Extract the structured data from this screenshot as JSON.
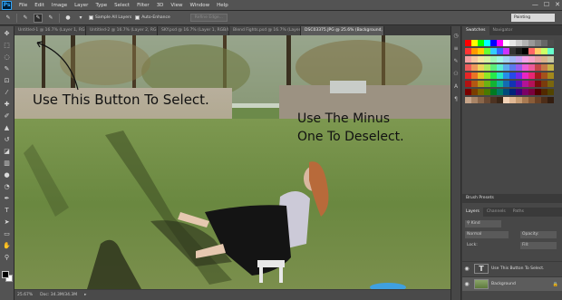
{
  "app": {
    "logo": "Ps",
    "menu": [
      "File",
      "Edit",
      "Image",
      "Layer",
      "Type",
      "Select",
      "Filter",
      "3D",
      "View",
      "Window",
      "Help"
    ],
    "window_controls": [
      "—",
      "☐",
      "✕"
    ]
  },
  "options": {
    "sample_all_layers": "Sample All Layers",
    "auto_enhance": "Auto-Enhance",
    "refine_edge": "Refine Edge...",
    "workspace": "Painting"
  },
  "tabs": [
    {
      "label": "Untitled-1 @ 16.7% (Layer 1, RGB/8)"
    },
    {
      "label": "Untitled-2 @ 16.7% (Layer 2, RGB/8)"
    },
    {
      "label": "SKY.psd @ 16.7% (Layer 1, RGB/8)"
    },
    {
      "label": "Blend Fights.psd @ 16.7% (Layer 1, RGB/8)"
    },
    {
      "label": "DSC03375.JPG @ 25.6% (Background, RGB/8)",
      "active": true
    }
  ],
  "canvas": {
    "text1": "Use This Button To Select.",
    "text2_line1": "Use The Minus",
    "text2_line2": "One To Deselect."
  },
  "status": {
    "zoom": "25.67%",
    "doc": "Doc: 34.3M/34.3M"
  },
  "right_panel": {
    "tab_swatches": "Swatches",
    "tab_navigator": "Navigator",
    "brush_presets": "Brush Presets",
    "layers_tabs": [
      "Layers",
      "Channels",
      "Paths"
    ],
    "kind_label": "Kind",
    "normal_label": "Normal",
    "opacity_label": "Opacity:",
    "lock_label": "Lock:",
    "fill_label": "Fill:",
    "layers": [
      {
        "name": "Use This Button To Select.",
        "type": "text",
        "thumb": "T"
      },
      {
        "name": "Background",
        "type": "image",
        "selected": true
      }
    ]
  },
  "colors": {
    "swatch_rows": [
      [
        "#ff0000",
        "#ffff00",
        "#00ff00",
        "#00ffff",
        "#0000ff",
        "#ff00ff",
        "#ffffff",
        "#e6e6e6",
        "#cccccc",
        "#b3b3b3",
        "#999999",
        "#808080",
        "#666666",
        "#4d4d4d"
      ],
      [
        "#ff3333",
        "#ff9900",
        "#ffcc00",
        "#66ff33",
        "#33ccff",
        "#3366ff",
        "#cc33ff",
        "#333333",
        "#1a1a1a",
        "#000000",
        "#ff6666",
        "#ffcc66",
        "#ccff66",
        "#66ffcc"
      ],
      [
        "#f5a3a3",
        "#f5c8a3",
        "#f5e6a3",
        "#d6f5a3",
        "#a3f5b8",
        "#a3f5e6",
        "#a3d6f5",
        "#a3b8f5",
        "#c8a3f5",
        "#f5a3e6",
        "#f5a3c8",
        "#e6a3a3",
        "#d9b38c",
        "#c8c8a3"
      ],
      [
        "#ed5c5c",
        "#ed9a5c",
        "#edd45c",
        "#aeed5c",
        "#5ced7a",
        "#5cedd4",
        "#5caeed",
        "#5c7aed",
        "#9a5ced",
        "#ed5cd4",
        "#ed5c9a",
        "#c44747",
        "#c47a47",
        "#c4b347"
      ],
      [
        "#e82626",
        "#e87426",
        "#e8c226",
        "#8ee826",
        "#26e84a",
        "#26e8c2",
        "#268ee8",
        "#264ae8",
        "#7426e8",
        "#e826c2",
        "#e82674",
        "#a31b1b",
        "#a3521b",
        "#a3881b"
      ],
      [
        "#b31212",
        "#b35812",
        "#b39612",
        "#6cb312",
        "#12b333",
        "#12b396",
        "#126cb3",
        "#1233b3",
        "#5812b3",
        "#b31296",
        "#b31258",
        "#7a0d0d",
        "#7a3c0d",
        "#7a660d"
      ],
      [
        "#7a0000",
        "#7a3d00",
        "#7a6600",
        "#4a7a00",
        "#007a22",
        "#007a66",
        "#004a7a",
        "#00227a",
        "#3d007a",
        "#7a0066",
        "#7a003d",
        "#520000",
        "#522900",
        "#524400"
      ],
      [
        "#c7a58a",
        "#a88466",
        "#8a664a",
        "#6b4a33",
        "#4d3322",
        "#3a2617",
        "#f2d3b8",
        "#e0b894",
        "#c79c73",
        "#a87a52",
        "#8a5c38",
        "#6b4226",
        "#4d2e19",
        "#331d0f"
      ]
    ]
  }
}
